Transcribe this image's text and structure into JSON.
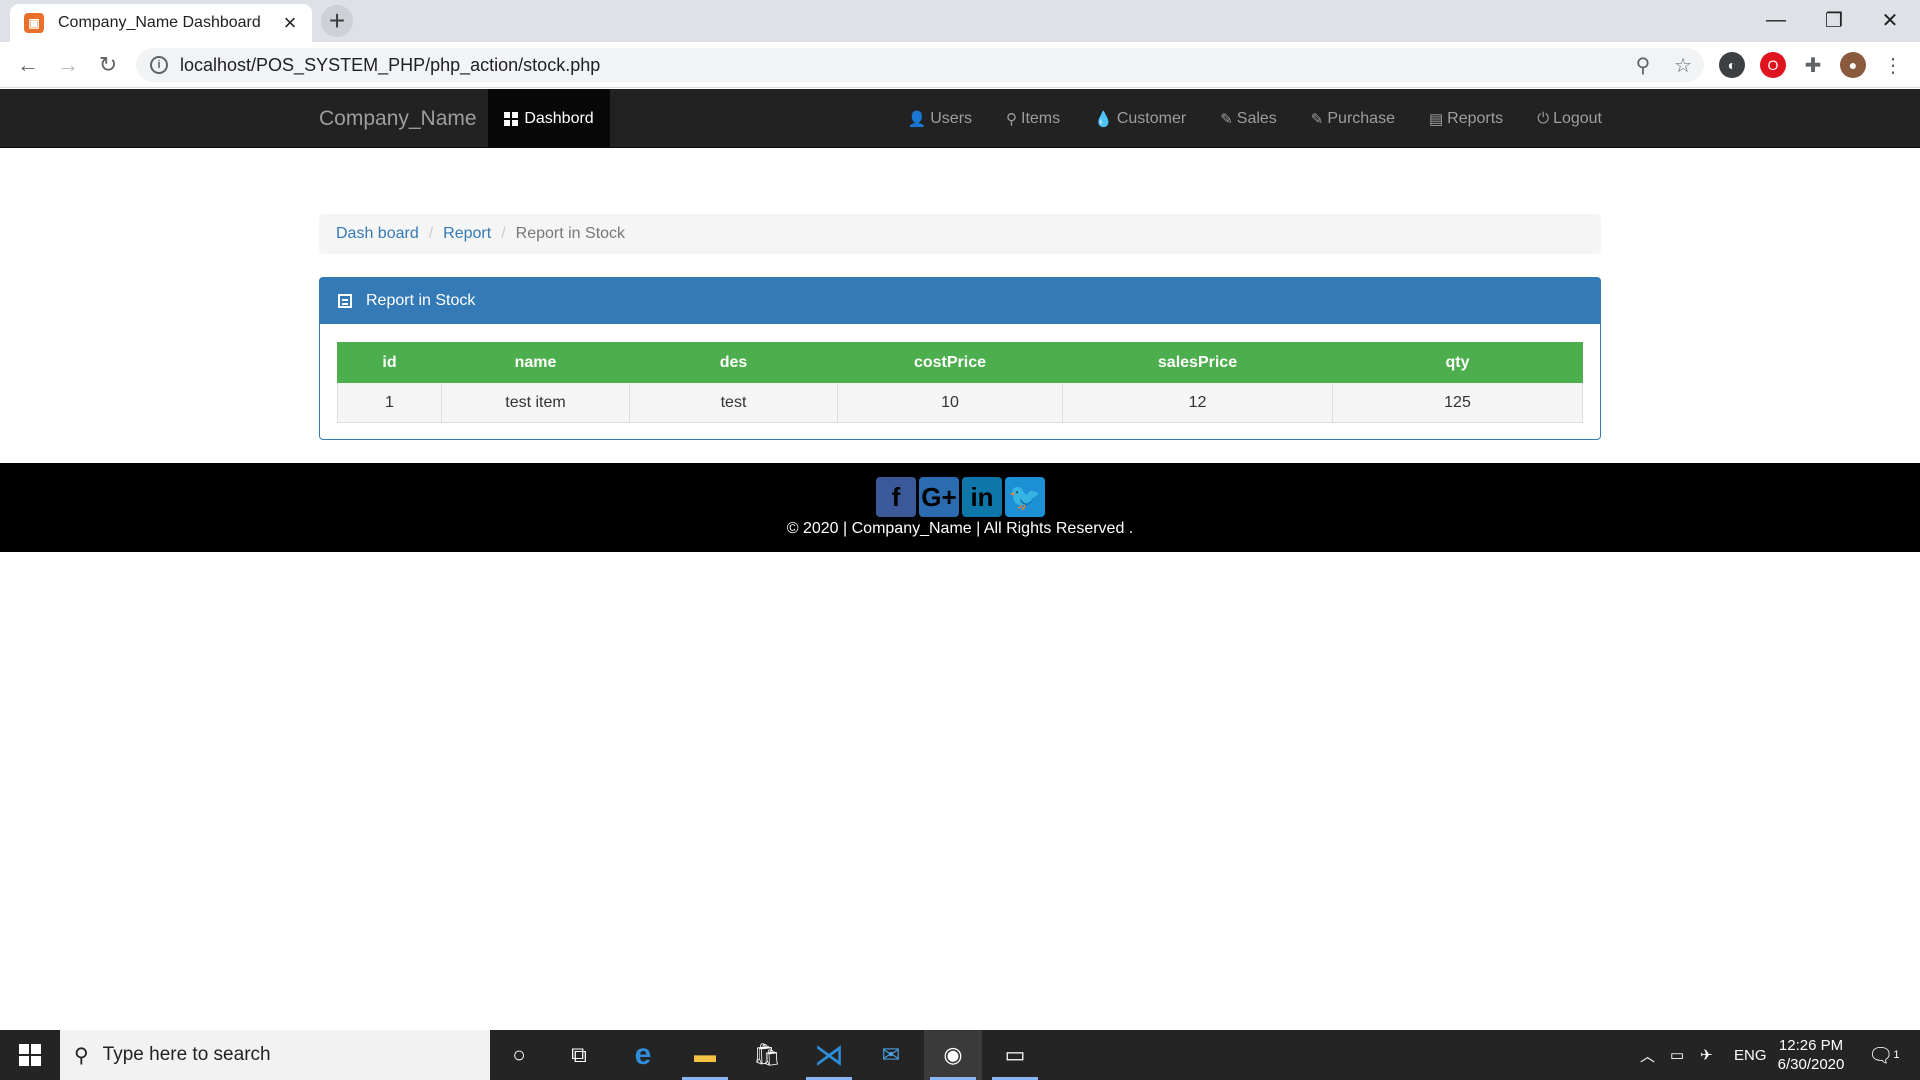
{
  "browser": {
    "tab_title": "Company_Name Dashboard",
    "tab_favicon_letter": "⌘",
    "url": "localhost/POS_SYSTEM_PHP/php_action/stock.php"
  },
  "navbar": {
    "brand": "Company_Name",
    "active_label": "Dashbord",
    "items": [
      {
        "label": "Users",
        "icon": "user-icon"
      },
      {
        "label": "Items",
        "icon": "map-marker-icon"
      },
      {
        "label": "Customer",
        "icon": "tint-icon"
      },
      {
        "label": "Sales",
        "icon": "pencil-icon"
      },
      {
        "label": "Purchase",
        "icon": "pencil-icon"
      },
      {
        "label": "Reports",
        "icon": "list-alt-icon"
      },
      {
        "label": "Logout",
        "icon": "power-icon"
      }
    ]
  },
  "breadcrumb": {
    "home": "Dash board",
    "report": "Report",
    "current": "Report in Stock"
  },
  "panel": {
    "title": "Report in Stock",
    "columns": [
      "id",
      "name",
      "des",
      "costPrice",
      "salesPrice",
      "qty"
    ],
    "rows": [
      [
        "1",
        "test item",
        "test",
        "10",
        "12",
        "125"
      ]
    ]
  },
  "footer": {
    "social": [
      "facebook-icon",
      "google-plus-icon",
      "linkedin-icon",
      "twitter-icon"
    ],
    "copyright": "© 2020 | Company_Name | All Rights Reserved ."
  },
  "taskbar": {
    "search_placeholder": "Type here to search",
    "language": "ENG",
    "time": "12:26 PM",
    "date": "6/30/2020",
    "notification_count": "1"
  }
}
